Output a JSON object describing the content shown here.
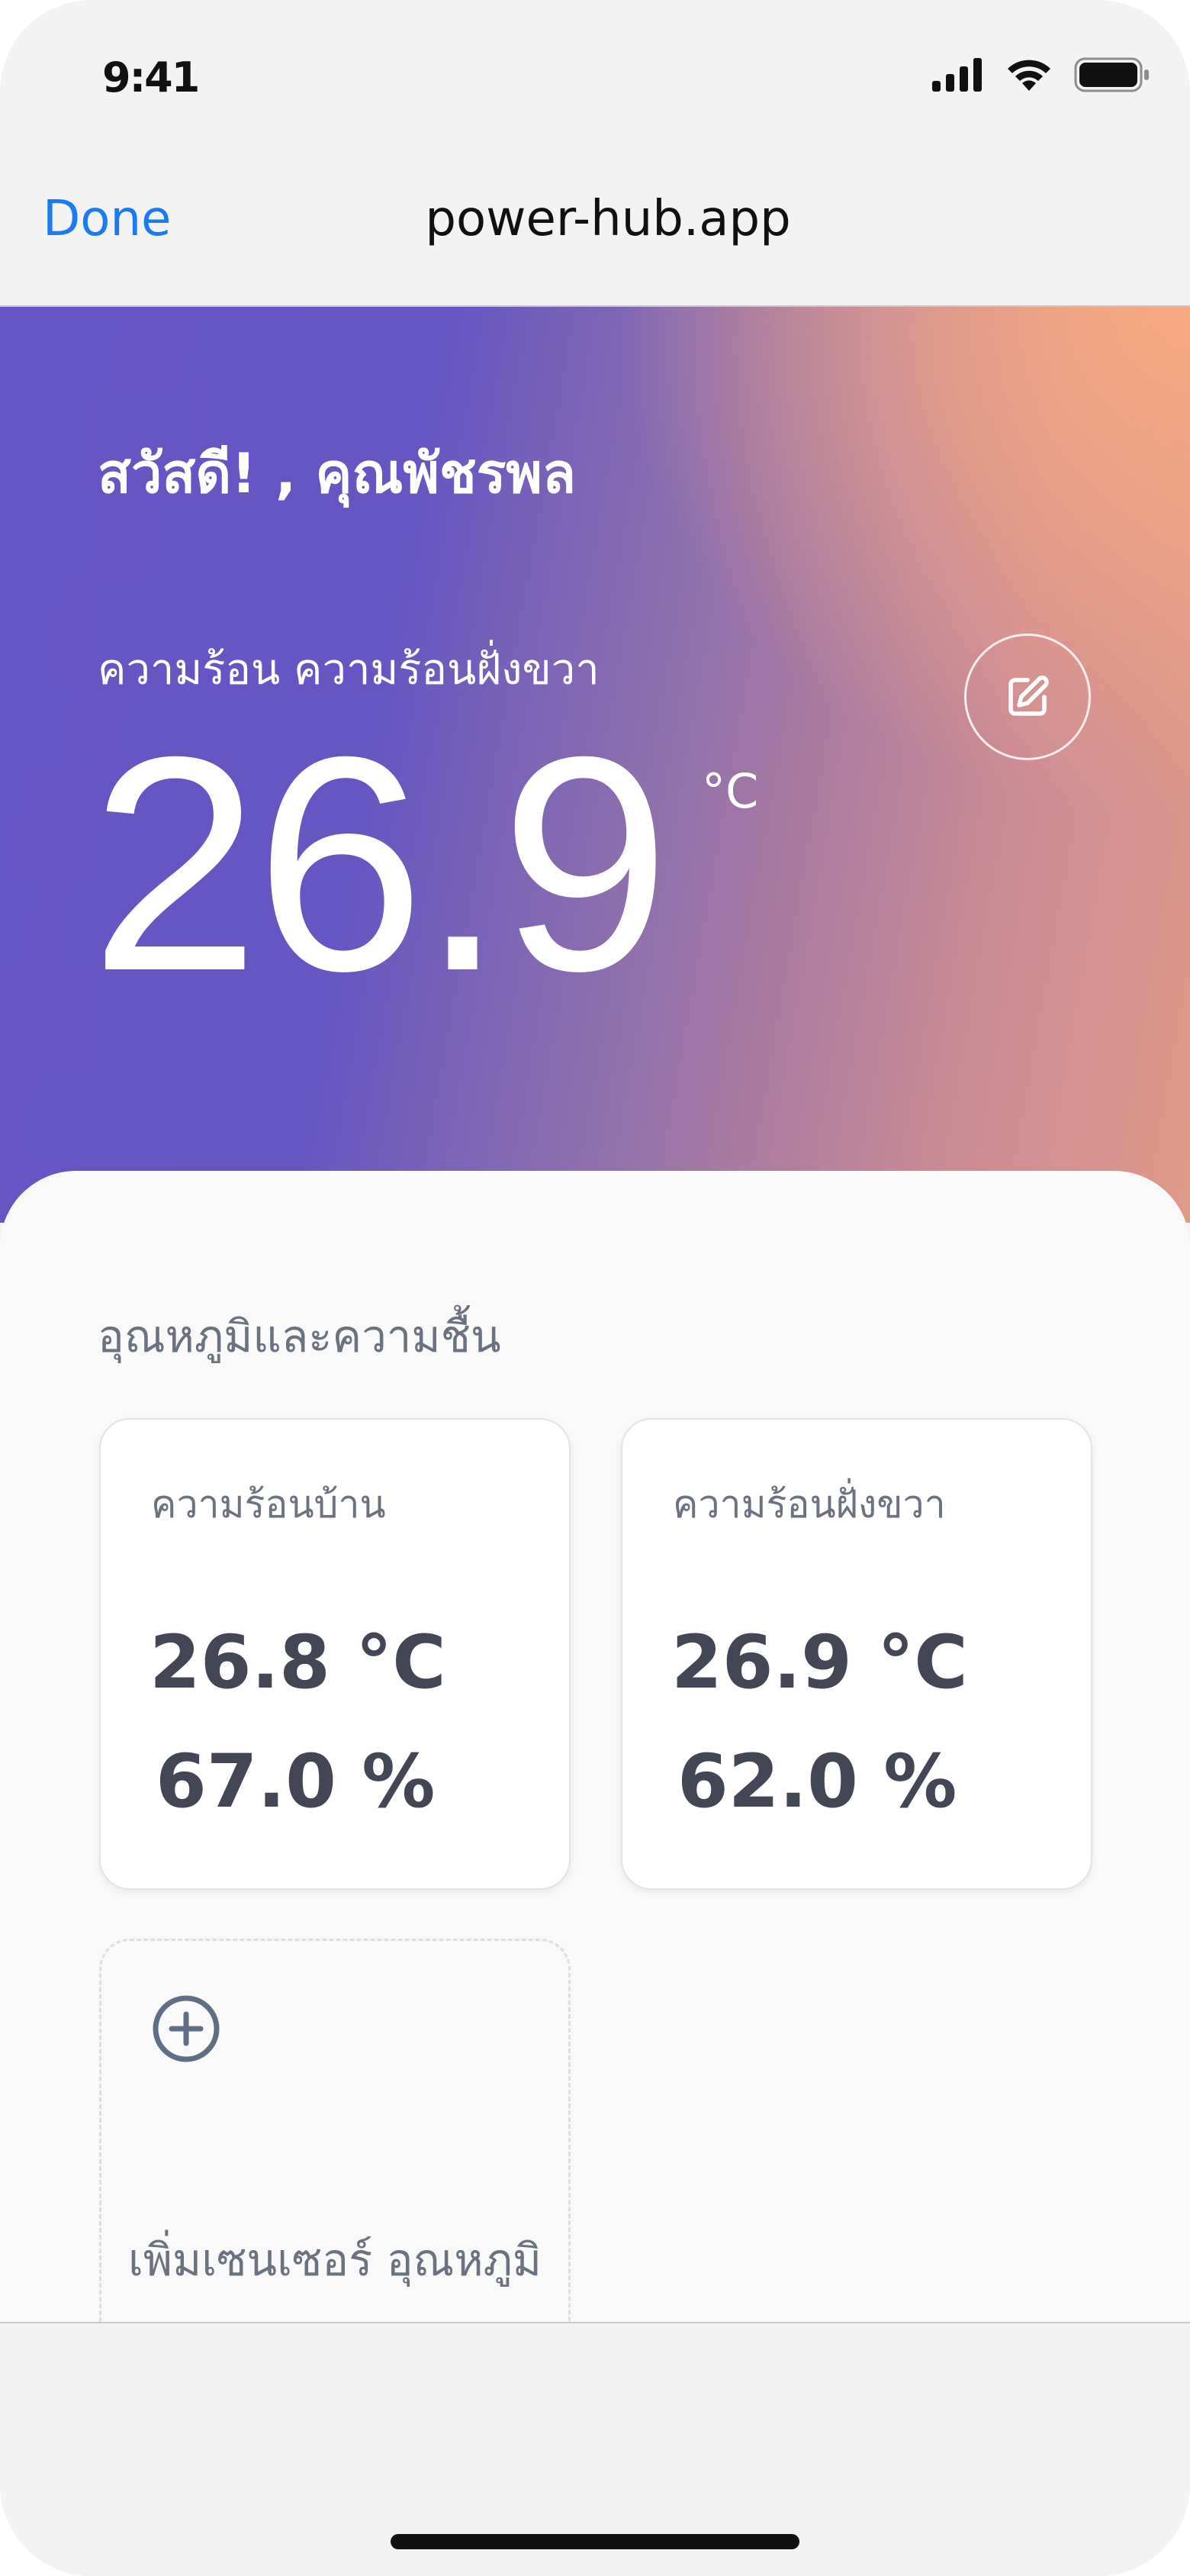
{
  "status_bar": {
    "time": "9:41"
  },
  "browser": {
    "done_label": "Done",
    "title": "power-hub.app"
  },
  "hero": {
    "greeting": "สวัสดี! , คุณพัชรพล",
    "sensor_name": "ความร้อน ความร้อนฝั่งขวา",
    "temperature": "26.9",
    "unit": "°C"
  },
  "section": {
    "title": "อุณหภูมิและความชื้น",
    "cards": [
      {
        "label": "ความร้อนบ้าน",
        "temperature": "26.8 °C",
        "humidity": "67.0 %"
      },
      {
        "label": "ความร้อนฝั่งขวา",
        "temperature": "26.9 °C",
        "humidity": "62.0 %"
      }
    ],
    "add_card": {
      "label": "เพิ่มเซนเซอร์ อุณหภูมิ"
    }
  },
  "colors": {
    "accent": "#1a7cf0",
    "gradient_start": "#6655c4",
    "gradient_end": "#f9a886",
    "card_text": "#434654",
    "muted_text": "#6b7280"
  },
  "icons": {
    "signal": "cellular-signal-icon",
    "wifi": "wifi-icon",
    "battery": "battery-icon",
    "edit": "edit-pencil-icon",
    "add": "plus-circle-icon"
  }
}
